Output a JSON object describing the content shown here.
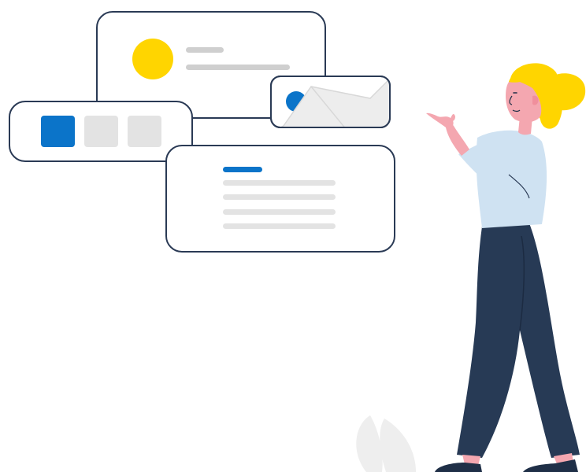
{
  "colors": {
    "outline": "#2a3a55",
    "card_bg": "#ffffff",
    "accent_yellow": "#ffd500",
    "accent_blue": "#0b74c9",
    "placeholder_gray": "#e3e3e3",
    "line_gray": "#cfcfcf",
    "skin": "#f4a7b0",
    "shirt": "#cfe2f2",
    "pants": "#273a55",
    "shoes": "#1f2f47",
    "leaf": "#eeeeee"
  },
  "cards": {
    "profile_card": {
      "icon": "avatar-circle"
    },
    "image_card": {
      "icon": "image-thumbnail"
    },
    "tile_selector": {
      "tiles": [
        "selected",
        "empty",
        "empty"
      ]
    },
    "text_card": {
      "icon": "text-lines"
    }
  },
  "illustration": {
    "figure": "woman-pointing",
    "plant": "leaf"
  }
}
